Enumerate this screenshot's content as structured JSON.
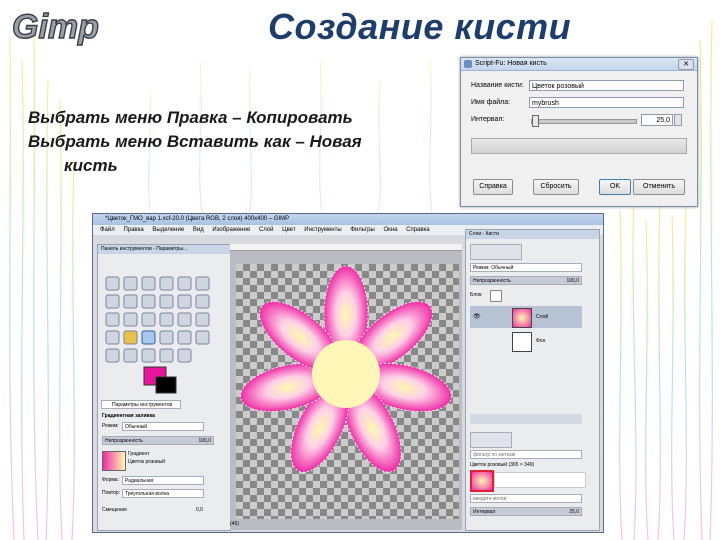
{
  "slide": {
    "logo_text": "Gimp",
    "title": "Создание кисти",
    "bullets": [
      "Выбрать меню Правка – Копировать",
      "Выбрать меню Вставить как – Новая",
      "кисть"
    ]
  },
  "dialog": {
    "title": "Script-Fu: Новая кисть",
    "close": "✕",
    "fields": [
      {
        "label": "Название кисти:",
        "value": "Цветок розовый"
      },
      {
        "label": "Имя файла:",
        "value": "mybrush"
      }
    ],
    "interval_label": "Интервал:",
    "interval_value": "25,0",
    "buttons": {
      "help": "Справка",
      "reset": "Сбросить",
      "ok": "OK",
      "cancel": "Отменить"
    }
  },
  "gimp": {
    "title": "*Цветок_ГМО_вар 1.xcf-20.0 (Цвета RGB, 2 слоя) 400x400 – GIMP",
    "menu": [
      "Файл",
      "Правка",
      "Выделение",
      "Вид",
      "Изображение",
      "Слой",
      "Цвет",
      "Инструменты",
      "Фильтры",
      "Окна",
      "Справка"
    ],
    "toolbox_title": "Панель инструментов - Параметры...",
    "tool_options_tab": "Параметры инструментов",
    "gradient_fill_label": "Градиентная заливка",
    "mode_label": "Режим:",
    "mode_value": "Обычный",
    "opacity_label": "Непрозрачность",
    "opacity_value": "100,0",
    "gradient_label": "Градиент",
    "gradient_value": "Цветок розовый",
    "shape_label": "Форма:",
    "shape_value": "Радиальная",
    "repeat_label": "Повтор:",
    "repeat_value": "Треугольная волна",
    "offset_label": "Смещение",
    "offset_value": "0,0",
    "status": "(46)",
    "layers_title": "Слои - Кисти",
    "layers_mode_value": "Режим: Обычный",
    "layers_opacity_label": "Непрозрачность",
    "layers_opacity_value": "100,0",
    "lock_label": "Блок:",
    "layer_names": [
      "Слой",
      "Фон"
    ],
    "brush_filter": "фильтр по меткам",
    "brush_name": "Цветок розовый (365 × 349)",
    "tags_input": "введите метки",
    "brush_interval_label": "Интервал",
    "brush_interval_value": "25,0"
  },
  "colors": {
    "title": "#1f3d6b",
    "flower_outer": "#ee2ea6",
    "flower_inner": "#fff8b0",
    "fg_swatch": "#e6159a"
  }
}
